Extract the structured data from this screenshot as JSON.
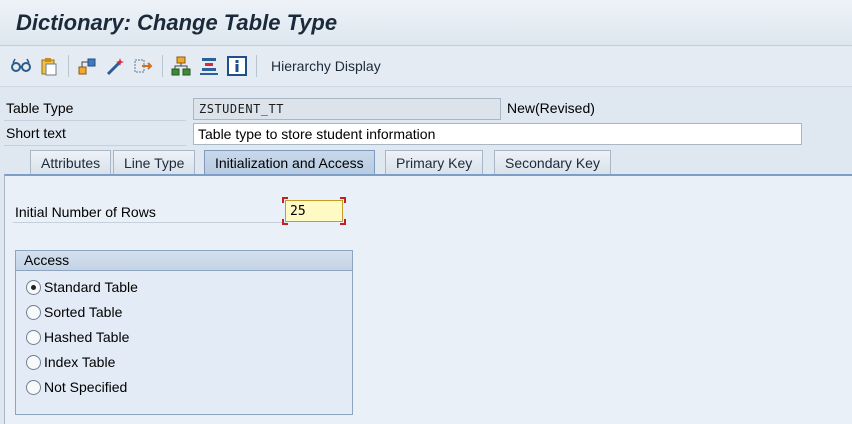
{
  "window": {
    "title": "Dictionary: Change Table Type"
  },
  "toolbar": {
    "icons": [
      "glasses-icon",
      "clipboard-icon",
      "hierarchy-icon",
      "magic-wand-icon",
      "move-icon",
      "structure-icon",
      "layer-stack-icon",
      "info-icon"
    ],
    "hierarchy_display_label": "Hierarchy Display"
  },
  "header": {
    "table_type_label": "Table Type",
    "table_type_value": "ZSTUDENT_TT",
    "status": "New(Revised)",
    "short_text_label": "Short text",
    "short_text_value": "Table type to store student information"
  },
  "tabs": [
    {
      "label": "Attributes",
      "active": false
    },
    {
      "label": "Line Type",
      "active": false
    },
    {
      "label": "Initialization and Access",
      "active": true
    },
    {
      "label": "Primary Key",
      "active": false
    },
    {
      "label": "Secondary Key",
      "active": false
    }
  ],
  "init_access": {
    "initial_rows_label": "Initial Number of Rows",
    "initial_rows_value": "25",
    "access_group_title": "Access",
    "access_options": [
      {
        "label": "Standard Table",
        "checked": true
      },
      {
        "label": "Sorted Table",
        "checked": false
      },
      {
        "label": "Hashed Table",
        "checked": false
      },
      {
        "label": "Index Table",
        "checked": false
      },
      {
        "label": "Not Specified",
        "checked": false
      }
    ]
  },
  "colors": {
    "title_text": "#1b2a3a",
    "active_tab": "#b7cbe2",
    "required_marker": "#c0202a",
    "input_highlight": "#fff9c4"
  }
}
